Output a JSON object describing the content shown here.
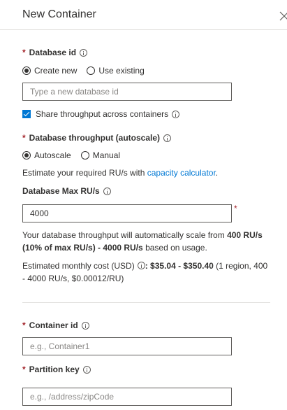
{
  "panel": {
    "title": "New Container"
  },
  "database_id": {
    "label": "Database id",
    "options": [
      "Create new",
      "Use existing"
    ],
    "selected": "Create new",
    "placeholder": "Type a new database id",
    "value": ""
  },
  "share_throughput": {
    "label": "Share throughput across containers",
    "checked": true
  },
  "throughput": {
    "label": "Database throughput (autoscale)",
    "options": [
      "Autoscale",
      "Manual"
    ],
    "selected": "Autoscale",
    "estimate_prefix": "Estimate your required RU/s with ",
    "estimate_link": "capacity calculator",
    "estimate_suffix": "."
  },
  "max_rus": {
    "label": "Database Max RU/s",
    "value": "4000",
    "autoscale_text_1": "Your database throughput will automatically scale from ",
    "autoscale_bold_1": "400 RU/s",
    "autoscale_bold_2": "(10% of max RU/s) - 4000 RU/s",
    "autoscale_text_2": " based on usage.",
    "cost_label": "Estimated monthly cost (USD)",
    "cost_value": ": $35.04 - $350.40",
    "cost_detail_1": " (1 region, 400",
    "cost_detail_2": "- 4000 RU/s, $0.00012/RU)"
  },
  "container_id": {
    "label": "Container id",
    "placeholder": "e.g., Container1",
    "value": ""
  },
  "partition_key": {
    "label": "Partition key",
    "placeholder": "e.g., /address/zipCode",
    "value": ""
  },
  "required_marker": "*",
  "colors": {
    "accent": "#0078d4",
    "required": "#a4262c",
    "text": "#323130"
  }
}
